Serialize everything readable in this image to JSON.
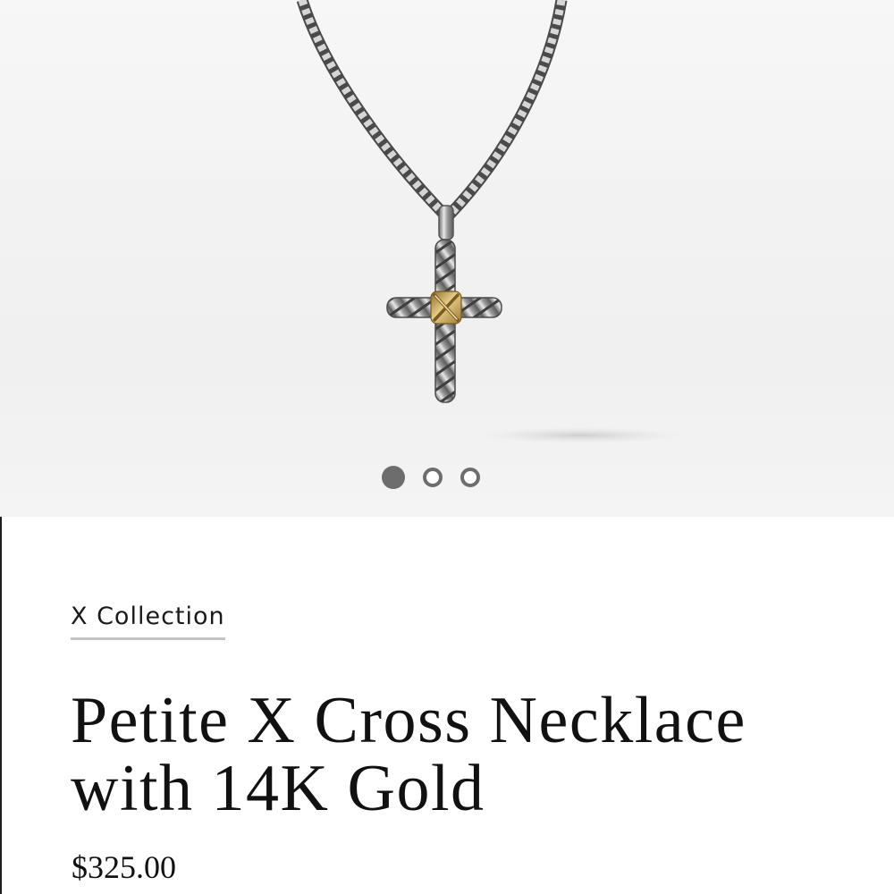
{
  "carousel": {
    "slide_count": 3,
    "active_index": 0
  },
  "product": {
    "collection_link": "X Collection",
    "title": "Petite X Cross Necklace with 14K Gold",
    "price": "$325.00"
  },
  "colors": {
    "silver": "#a9a9a9",
    "gold": "#c9a85a",
    "dot": "#6d6d6d",
    "underline": "#c4c4c4"
  }
}
